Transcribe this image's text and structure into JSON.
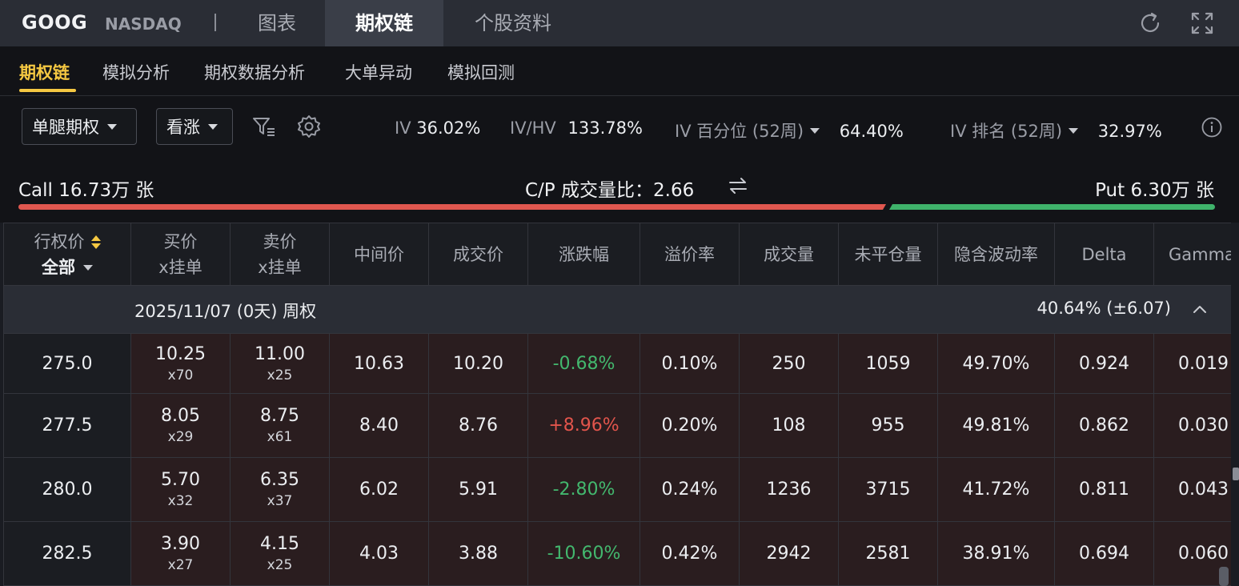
{
  "header": {
    "ticker": "GOOG",
    "exchange": "NASDAQ",
    "tabs": [
      {
        "label": "图表",
        "active": false
      },
      {
        "label": "期权链",
        "active": true
      },
      {
        "label": "个股资料",
        "active": false
      }
    ],
    "icons": [
      "refresh-icon",
      "fullscreen-icon"
    ]
  },
  "subtabs": [
    {
      "label": "期权链",
      "active": true
    },
    {
      "label": "模拟分析",
      "active": false
    },
    {
      "label": "期权数据分析",
      "active": false
    },
    {
      "label": "大单异动",
      "active": false
    },
    {
      "label": "模拟回测",
      "active": false
    }
  ],
  "controls": {
    "leg_type": "单腿期权",
    "direction": "看涨",
    "stats": {
      "iv_label": "IV",
      "iv_value": "36.02%",
      "ivhv_label": "IV/HV",
      "ivhv_value": "133.78%",
      "iv_pct_label": "IV 百分位 (52周)",
      "iv_pct_value": "64.40%",
      "iv_rank_label": "IV 排名 (52周)",
      "iv_rank_value": "32.97%"
    }
  },
  "volume_ratio": {
    "call": "Call 16.73万 张",
    "put": "Put 6.30万 张",
    "cp_label": "C/P 成交量比：",
    "cp_value": "2.66",
    "call_fraction": 0.726,
    "call_color": "#e0574f",
    "put_color": "#3fb36b"
  },
  "table": {
    "headers": {
      "strike": "行权价",
      "filter": "全部",
      "bid_1": "买价",
      "bid_2": "x挂单",
      "ask_1": "卖价",
      "ask_2": "x挂单",
      "mid": "中间价",
      "last": "成交价",
      "change": "涨跌幅",
      "premium": "溢价率",
      "volume": "成交量",
      "oi": "未平仓量",
      "iv": "隐含波动率",
      "delta": "Delta",
      "gamma": "Gamma"
    },
    "group": {
      "date": "2025/11/07 (0天) 周权",
      "iv": "40.64%  (±6.07)"
    },
    "rows": [
      {
        "strike": "275.0",
        "bid": "10.25",
        "bid_size": "x70",
        "ask": "11.00",
        "ask_size": "x25",
        "mid": "10.63",
        "last": "10.20",
        "change": "-0.68%",
        "premium": "0.10%",
        "volume": "250",
        "oi": "1059",
        "iv": "49.70%",
        "delta": "0.924",
        "gamma": "0.019"
      },
      {
        "strike": "277.5",
        "bid": "8.05",
        "bid_size": "x29",
        "ask": "8.75",
        "ask_size": "x61",
        "mid": "8.40",
        "last": "8.76",
        "change": "+8.96%",
        "premium": "0.20%",
        "volume": "108",
        "oi": "955",
        "iv": "49.81%",
        "delta": "0.862",
        "gamma": "0.030"
      },
      {
        "strike": "280.0",
        "bid": "5.70",
        "bid_size": "x32",
        "ask": "6.35",
        "ask_size": "x37",
        "mid": "6.02",
        "last": "5.91",
        "change": "-2.80%",
        "premium": "0.24%",
        "volume": "1236",
        "oi": "3715",
        "iv": "41.72%",
        "delta": "0.811",
        "gamma": "0.043"
      },
      {
        "strike": "282.5",
        "bid": "3.90",
        "bid_size": "x27",
        "ask": "4.15",
        "ask_size": "x25",
        "mid": "4.03",
        "last": "3.88",
        "change": "-10.60%",
        "premium": "0.42%",
        "volume": "2942",
        "oi": "2581",
        "iv": "38.91%",
        "delta": "0.694",
        "gamma": "0.060"
      }
    ]
  }
}
